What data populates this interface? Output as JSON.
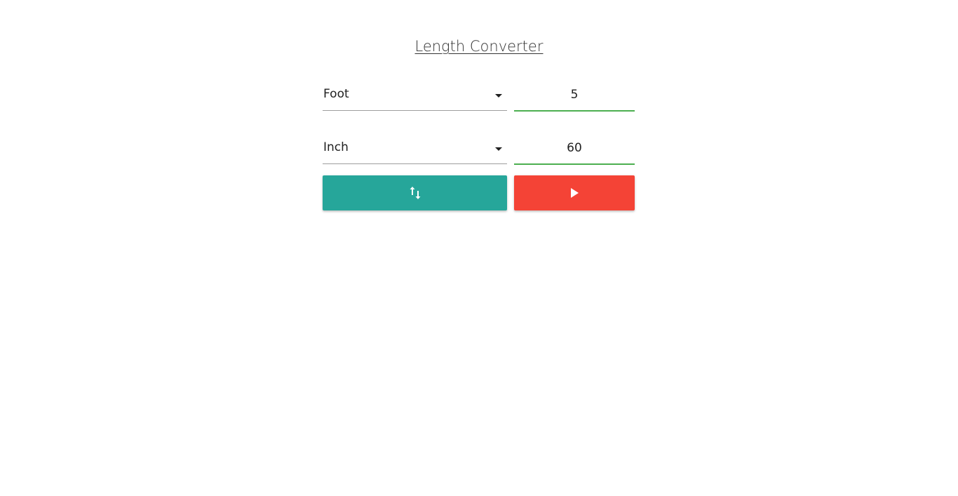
{
  "title": "Length Converter",
  "from": {
    "unit": "Foot",
    "value": "5"
  },
  "to": {
    "unit": "Inch",
    "value": "60"
  },
  "buttons": {
    "swap_icon": "swap-vertical-icon",
    "convert_icon": "play-icon"
  },
  "colors": {
    "swap_button": "#26a69a",
    "convert_button": "#f44336",
    "input_underline": "#4caf50"
  }
}
